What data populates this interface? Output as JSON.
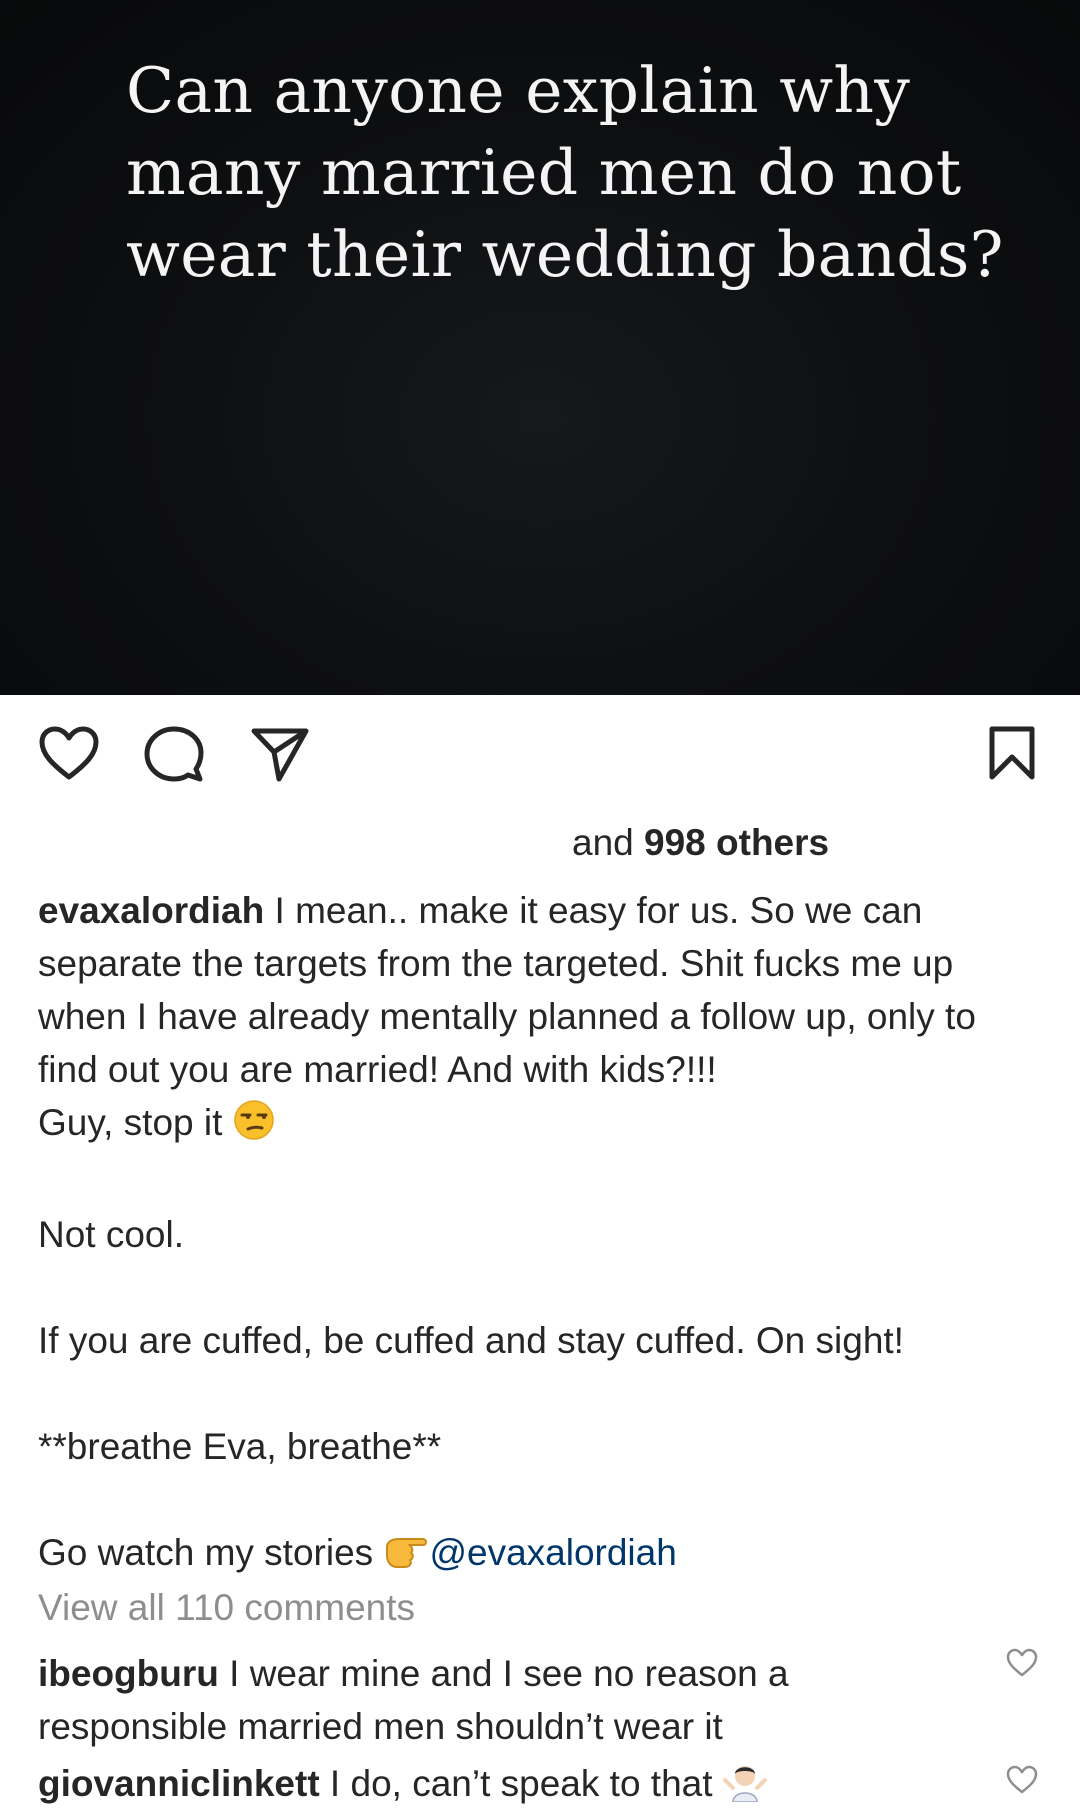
{
  "post": {
    "quote_lines": "Can anyone explain why\nmany married men do not\nwear their wedding bands?",
    "colors": {
      "background": "#0d0e10",
      "text": "#f4f4f4"
    }
  },
  "actions": {
    "like_icon": "heart-outline-icon",
    "comment_icon": "comment-bubble-icon",
    "share_icon": "paper-plane-icon",
    "save_icon": "bookmark-icon"
  },
  "likes": {
    "prefix": "and ",
    "count_text": "998 others"
  },
  "caption": {
    "username": "evaxalordiah",
    "line1": " I mean.. make it easy for us. So we can separate the targets from the targeted. Shit fucks me up when I have already mentally planned a follow up, only to find out you are married! And with kids?!!!",
    "line2": "Guy, stop it ",
    "line2_emoji": "unamused-face-emoji",
    "line3": "Not cool.",
    "line4": "If you are cuffed, be cuffed and stay cuffed. On sight!",
    "line5": "**breathe Eva, breathe**",
    "line6": "Go watch my stories ",
    "line6_emoji": "pointing-right-hand-emoji",
    "mention": "@evaxalordiah"
  },
  "view_all_comments": "View all 110 comments",
  "comments": [
    {
      "username": "ibeogburu",
      "text": " I wear mine and I see no reason a responsible married men shouldn’t wear it"
    },
    {
      "username": "giovanniclinkett",
      "text": " I do, can’t speak to that ",
      "emoji": "person-shrugging-emoji"
    }
  ],
  "colors": {
    "text": "#262626",
    "muted": "#8e8e8e",
    "mention": "#00376b"
  }
}
